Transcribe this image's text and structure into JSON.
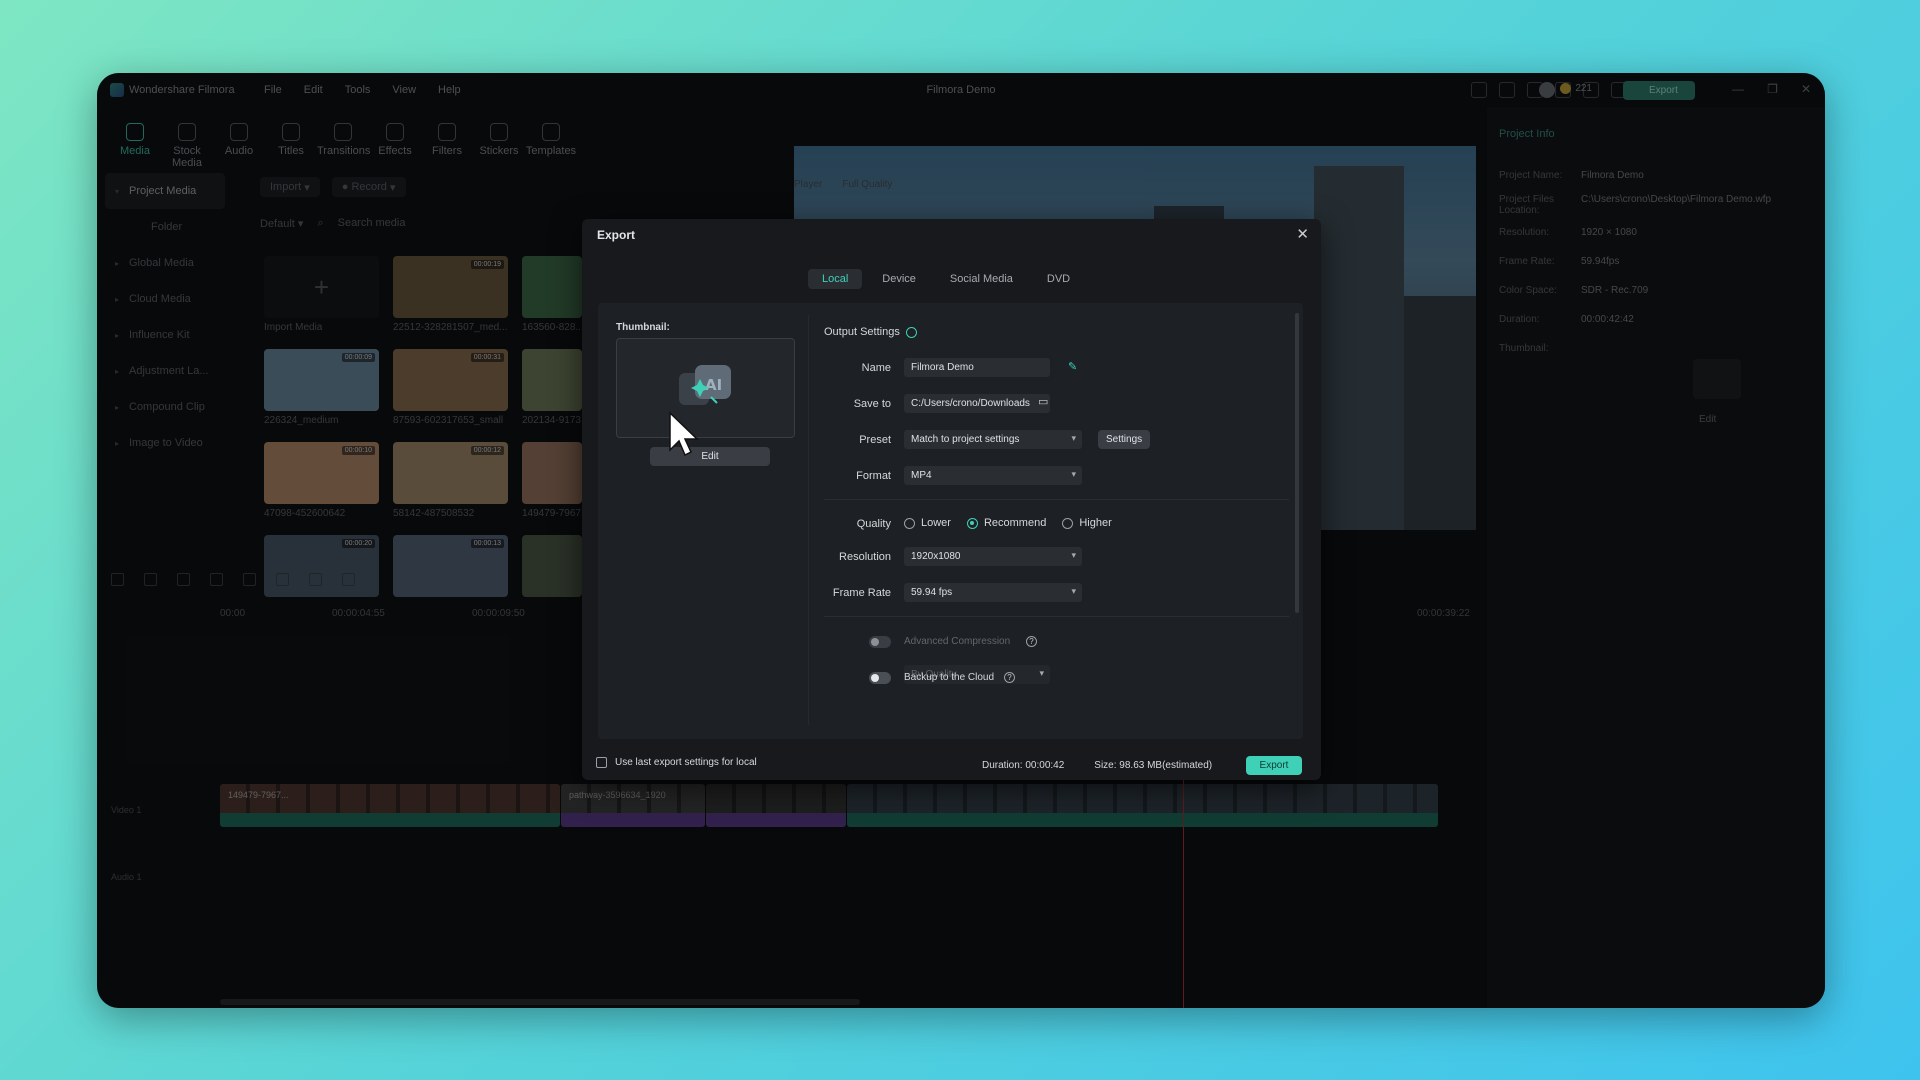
{
  "app": {
    "name": "Wondershare Filmora",
    "menu": [
      "File",
      "Edit",
      "Tools",
      "View",
      "Help"
    ],
    "project_title": "Filmora Demo",
    "credits": "221",
    "export_label": "Export",
    "window_controls": [
      "—",
      "❐",
      "✕"
    ]
  },
  "toolbar": [
    "Media",
    "Stock Media",
    "Audio",
    "Titles",
    "Transitions",
    "Effects",
    "Filters",
    "Stickers",
    "Templates"
  ],
  "sidebar": {
    "items": [
      {
        "label": "Project Media",
        "active": true
      },
      {
        "label": "Folder",
        "sub": true
      },
      {
        "label": "Global Media"
      },
      {
        "label": "Cloud Media"
      },
      {
        "label": "Influence Kit"
      },
      {
        "label": "Adjustment La..."
      },
      {
        "label": "Compound Clip"
      },
      {
        "label": "Image to Video"
      }
    ]
  },
  "media": {
    "import_label": "Import",
    "record_label": "Record",
    "sort_label": "Default",
    "search_placeholder": "Search media",
    "import_media_label": "Import Media",
    "items": [
      {
        "label": "22512-328281507_med...",
        "duration": "00:00:19",
        "color": "#6b5a3e"
      },
      {
        "label": "163560-828...",
        "duration": "",
        "color": "#3f6a4a"
      },
      {
        "label": "226324_medium",
        "duration": "00:00:09",
        "color": "#6a8aa0"
      },
      {
        "label": "87593-602317653_small",
        "duration": "00:00:31",
        "color": "#8a6d4f"
      },
      {
        "label": "202134-9173...",
        "duration": "",
        "color": "#6f7d5a"
      },
      {
        "label": "47098-452600642",
        "duration": "00:00:10",
        "color": "#b58b6a"
      },
      {
        "label": "58142-487508532",
        "duration": "00:00:12",
        "color": "#a58a6a"
      },
      {
        "label": "149479-7967...",
        "duration": "",
        "color": "#9a7660"
      },
      {
        "label": "",
        "duration": "00:00:20",
        "color": "#4a5a6a"
      },
      {
        "label": "",
        "duration": "00:00:13",
        "color": "#566478"
      },
      {
        "label": "",
        "duration": "",
        "color": "#4d5a48"
      }
    ]
  },
  "preview": {
    "tabs": [
      "Player",
      "Full Quality"
    ]
  },
  "project_info": {
    "title": "Project Info",
    "rows": [
      {
        "k": "Project Name:",
        "v": "Filmora Demo"
      },
      {
        "k": "Project Files Location:",
        "v": "C:\\Users\\crono\\Desktop\\Filmora Demo.wfp"
      },
      {
        "k": "Resolution:",
        "v": "1920 × 1080"
      },
      {
        "k": "Frame Rate:",
        "v": "59.94fps"
      },
      {
        "k": "Color Space:",
        "v": "SDR - Rec.709"
      },
      {
        "k": "Duration:",
        "v": "00:00:42:42"
      },
      {
        "k": "Thumbnail:",
        "v": ""
      }
    ],
    "edit_label": "Edit"
  },
  "timeline": {
    "ruler": [
      "00:00",
      "00:00:04:55",
      "00:00:09:50",
      "00:00:39:22"
    ],
    "video_track_label": "Video 1",
    "audio_track_label": "Audio 1",
    "clips": [
      {
        "title": "149479-7967...",
        "color": "#1f6e5e",
        "thumb": "#5b3f35"
      },
      {
        "title": "pathway-3596634_1920",
        "color": "#5a3d8a",
        "thumb": "#4a4a4a"
      },
      {
        "title": "",
        "color": "#5a3d8a",
        "thumb": "#3d3d3d"
      },
      {
        "title": "",
        "color": "#1f6e5e",
        "thumb": "#3c4a55"
      }
    ]
  },
  "dialog": {
    "title": "Export",
    "tabs": [
      {
        "label": "Local",
        "active": true
      },
      {
        "label": "Device"
      },
      {
        "label": "Social Media"
      },
      {
        "label": "DVD"
      }
    ],
    "thumbnail_label": "Thumbnail:",
    "thumbnail_edit": "Edit",
    "output_settings_label": "Output Settings",
    "name_label": "Name",
    "name_value": "Filmora Demo",
    "save_to_label": "Save to",
    "save_to_value": "C:/Users/crono/Downloads",
    "preset_label": "Preset",
    "preset_value": "Match to project settings",
    "settings_button": "Settings",
    "format_label": "Format",
    "format_value": "MP4",
    "quality_label": "Quality",
    "quality_options": [
      "Lower",
      "Recommend",
      "Higher"
    ],
    "quality_selected": "Recommend",
    "resolution_label": "Resolution",
    "resolution_value": "1920x1080",
    "frame_rate_label": "Frame Rate",
    "frame_rate_value": "59.94 fps",
    "advanced_compression_label": "Advanced Compression",
    "by_quality_value": "By Quality",
    "backup_label": "Backup to the Cloud",
    "use_last_label": "Use last export settings for local",
    "duration_text": "Duration: 00:00:42",
    "size_text": "Size: 98.63 MB(estimated)",
    "export_button": "Export"
  }
}
